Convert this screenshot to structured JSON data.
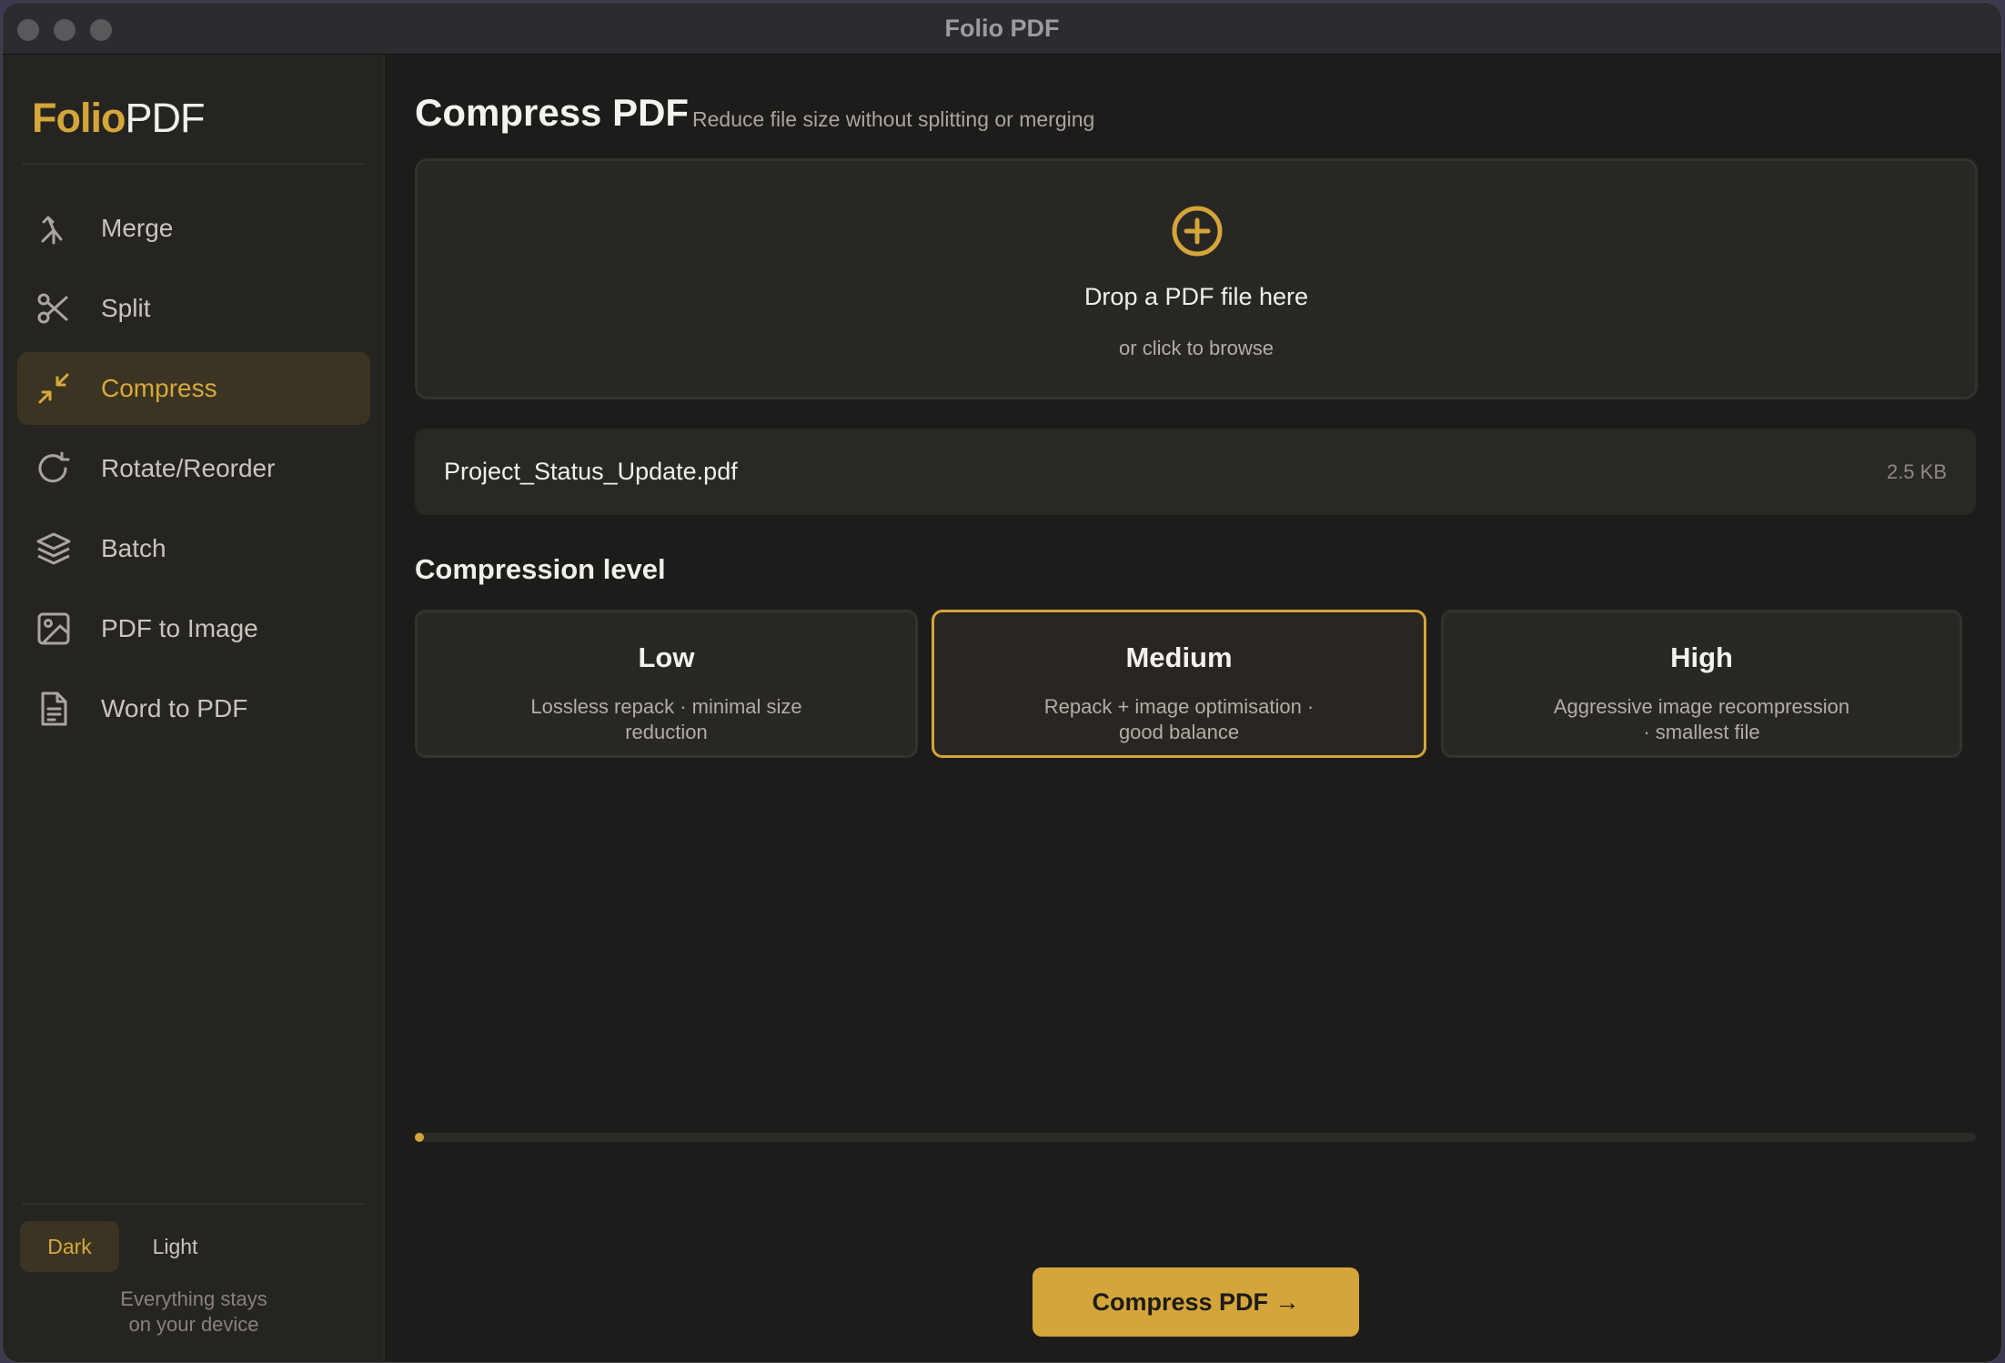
{
  "window": {
    "title": "Folio PDF"
  },
  "sidebar": {
    "logo": {
      "part1": "Folio",
      "part2": "PDF"
    },
    "items": [
      {
        "label": "Merge",
        "icon": "merge-icon",
        "active": false
      },
      {
        "label": "Split",
        "icon": "scissors-icon",
        "active": false
      },
      {
        "label": "Compress",
        "icon": "compress-icon",
        "active": true
      },
      {
        "label": "Rotate/Reorder",
        "icon": "rotate-icon",
        "active": false
      },
      {
        "label": "Batch",
        "icon": "layers-icon",
        "active": false
      },
      {
        "label": "PDF to Image",
        "icon": "image-icon",
        "active": false
      },
      {
        "label": "Word to PDF",
        "icon": "document-icon",
        "active": false
      }
    ],
    "theme": {
      "dark_label": "Dark",
      "light_label": "Light",
      "selected": "Dark"
    },
    "footnote": {
      "line1": "Everything stays",
      "line2": "on your device"
    }
  },
  "main": {
    "title": "Compress PDF",
    "subtitle": "Reduce file size without splitting or merging",
    "dropzone": {
      "icon": "plus-circle-icon",
      "title": "Drop a PDF file here",
      "subtitle": "or click to browse"
    },
    "file": {
      "name": "Project_Status_Update.pdf",
      "size": "2.5 KB"
    },
    "compression": {
      "label": "Compression level",
      "selected": "Medium",
      "levels": [
        {
          "title": "Low",
          "desc_line1": "Lossless repack  ·  minimal size",
          "desc_line2": "reduction"
        },
        {
          "title": "Medium",
          "desc_line1": "Repack + image optimisation  ·",
          "desc_line2": "good balance"
        },
        {
          "title": "High",
          "desc_line1": "Aggressive image recompression",
          "desc_line2": "·  smallest file"
        }
      ]
    },
    "progress": {
      "value_percent": 0
    },
    "action_button": "Compress PDF →"
  },
  "colors": {
    "accent": "#d4a53a",
    "background": "#1d1c1a",
    "sidebar": "#252420",
    "card": "#282723"
  }
}
